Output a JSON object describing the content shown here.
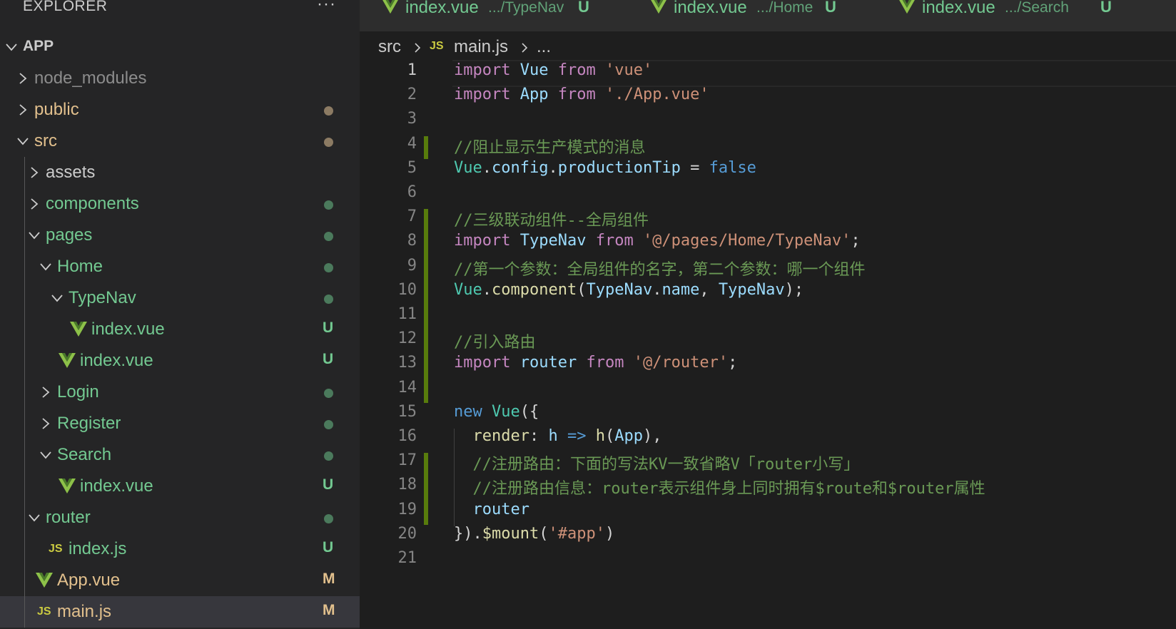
{
  "explorer": {
    "title": "EXPLORER",
    "more": "···",
    "tree": [
      {
        "label": "APP",
        "kind": "folder",
        "open": true,
        "depth": 0,
        "color": "#cccccc",
        "bold": true
      },
      {
        "label": "node_modules",
        "kind": "folder",
        "open": false,
        "depth": 1,
        "color": "#8c8c8c"
      },
      {
        "label": "public",
        "kind": "folder",
        "open": false,
        "depth": 1,
        "color": "#e2c08d",
        "dot": "#8c7b63"
      },
      {
        "label": "src",
        "kind": "folder",
        "open": true,
        "depth": 1,
        "color": "#e2c08d",
        "dot": "#8c7b63"
      },
      {
        "label": "assets",
        "kind": "folder",
        "open": false,
        "depth": 2,
        "color": "#cccccc"
      },
      {
        "label": "components",
        "kind": "folder",
        "open": false,
        "depth": 2,
        "color": "#73c991",
        "dot": "#4b7a5c"
      },
      {
        "label": "pages",
        "kind": "folder",
        "open": true,
        "depth": 2,
        "color": "#73c991",
        "dot": "#4b7a5c"
      },
      {
        "label": "Home",
        "kind": "folder",
        "open": true,
        "depth": 3,
        "color": "#73c991",
        "dot": "#4b7a5c"
      },
      {
        "label": "TypeNav",
        "kind": "folder",
        "open": true,
        "depth": 4,
        "color": "#73c991",
        "dot": "#4b7a5c"
      },
      {
        "label": "index.vue",
        "kind": "vue",
        "depth": 5,
        "color": "#73c991",
        "badge": "U",
        "badge_color": "#73c991"
      },
      {
        "label": "index.vue",
        "kind": "vue",
        "depth": 4,
        "color": "#73c991",
        "badge": "U",
        "badge_color": "#73c991"
      },
      {
        "label": "Login",
        "kind": "folder",
        "open": false,
        "depth": 3,
        "color": "#73c991",
        "dot": "#4b7a5c"
      },
      {
        "label": "Register",
        "kind": "folder",
        "open": false,
        "depth": 3,
        "color": "#73c991",
        "dot": "#4b7a5c"
      },
      {
        "label": "Search",
        "kind": "folder",
        "open": true,
        "depth": 3,
        "color": "#73c991",
        "dot": "#4b7a5c"
      },
      {
        "label": "index.vue",
        "kind": "vue",
        "depth": 4,
        "color": "#73c991",
        "badge": "U",
        "badge_color": "#73c991"
      },
      {
        "label": "router",
        "kind": "folder",
        "open": true,
        "depth": 2,
        "color": "#73c991",
        "dot": "#4b7a5c"
      },
      {
        "label": "index.js",
        "kind": "js",
        "depth": 3,
        "color": "#73c991",
        "badge": "U",
        "badge_color": "#73c991"
      },
      {
        "label": "App.vue",
        "kind": "vue",
        "depth": 2,
        "color": "#e2c08d",
        "badge": "M",
        "badge_color": "#e2c08d"
      },
      {
        "label": "main.js",
        "kind": "js",
        "depth": 2,
        "color": "#e2c08d",
        "badge": "M",
        "badge_color": "#e2c08d",
        "selected": true
      }
    ]
  },
  "tabs": [
    {
      "name": "index.vue",
      "path": ".../TypeNav",
      "badge": "U"
    },
    {
      "name": "index.vue",
      "path": ".../Home",
      "badge": "U"
    },
    {
      "name": "index.vue",
      "path": ".../Search",
      "badge": "U"
    }
  ],
  "breadcrumb": {
    "folder": "src",
    "js_badge": "JS",
    "file": "main.js",
    "more": "..."
  },
  "editor": {
    "active_line": 1,
    "lines": [
      {
        "n": "1",
        "tokens": [
          [
            "kw",
            "import"
          ],
          [
            "",
            "",
            " "
          ],
          [
            "vr",
            "Vue"
          ],
          [
            "",
            " "
          ],
          [
            "kw",
            "from"
          ],
          [
            "",
            " "
          ],
          [
            "str",
            "'vue'"
          ]
        ]
      },
      {
        "n": "2",
        "tokens": [
          [
            "kw",
            "import"
          ],
          [
            "",
            " "
          ],
          [
            "vr",
            "App"
          ],
          [
            "",
            " "
          ],
          [
            "kw",
            "from"
          ],
          [
            "",
            " "
          ],
          [
            "str",
            "'./App.vue'"
          ]
        ]
      },
      {
        "n": "3",
        "tokens": []
      },
      {
        "n": "4",
        "tokens": [
          [
            "cmt",
            "//阻止显示生产模式的消息"
          ]
        ]
      },
      {
        "n": "5",
        "tokens": [
          [
            "cls",
            "Vue"
          ],
          [
            "",
            "."
          ],
          [
            "vr",
            "config"
          ],
          [
            "",
            "."
          ],
          [
            "vr",
            "productionTip"
          ],
          [
            "",
            " = "
          ],
          [
            "kw2",
            "false"
          ]
        ]
      },
      {
        "n": "6",
        "tokens": []
      },
      {
        "n": "7",
        "tokens": [
          [
            "cmt",
            "//三级联动组件--全局组件"
          ]
        ]
      },
      {
        "n": "8",
        "tokens": [
          [
            "kw",
            "import"
          ],
          [
            "",
            " "
          ],
          [
            "vr",
            "TypeNav"
          ],
          [
            "",
            " "
          ],
          [
            "kw",
            "from"
          ],
          [
            "",
            " "
          ],
          [
            "str",
            "'@/pages/Home/TypeNav'"
          ],
          [
            "",
            ";"
          ]
        ]
      },
      {
        "n": "9",
        "tokens": [
          [
            "cmt",
            "//第一个参数：全局组件的名字，第二个参数：哪一个组件"
          ]
        ]
      },
      {
        "n": "10",
        "tokens": [
          [
            "cls",
            "Vue"
          ],
          [
            "",
            "."
          ],
          [
            "fn",
            "component"
          ],
          [
            "",
            "("
          ],
          [
            "vr",
            "TypeNav"
          ],
          [
            "",
            "."
          ],
          [
            "vr",
            "name"
          ],
          [
            "",
            ", "
          ],
          [
            "vr",
            "TypeNav"
          ],
          [
            "",
            ");"
          ]
        ]
      },
      {
        "n": "11",
        "tokens": []
      },
      {
        "n": "12",
        "tokens": [
          [
            "cmt",
            "//引入路由"
          ]
        ]
      },
      {
        "n": "13",
        "tokens": [
          [
            "kw",
            "import"
          ],
          [
            "",
            " "
          ],
          [
            "vr",
            "router"
          ],
          [
            "",
            " "
          ],
          [
            "kw",
            "from"
          ],
          [
            "",
            " "
          ],
          [
            "str",
            "'@/router'"
          ],
          [
            "",
            ";"
          ]
        ]
      },
      {
        "n": "14",
        "tokens": []
      },
      {
        "n": "15",
        "tokens": [
          [
            "kw2",
            "new"
          ],
          [
            "",
            " "
          ],
          [
            "cls",
            "Vue"
          ],
          [
            "",
            "({"
          ]
        ]
      },
      {
        "n": "16",
        "tokens": [
          [
            "",
            " "
          ],
          [
            "",
            " "
          ],
          [
            "fn",
            "render"
          ],
          [
            "",
            ": "
          ],
          [
            "vr",
            "h"
          ],
          [
            "",
            " "
          ],
          [
            "kw2",
            "=>"
          ],
          [
            "",
            " "
          ],
          [
            "fn",
            "h"
          ],
          [
            "",
            "("
          ],
          [
            "vr",
            "App"
          ],
          [
            "",
            "),"
          ]
        ]
      },
      {
        "n": "17",
        "tokens": [
          [
            "",
            "  "
          ],
          [
            "cmt",
            "//注册路由：下面的写法KV一致省略V「router小写」"
          ]
        ]
      },
      {
        "n": "18",
        "tokens": [
          [
            "",
            "  "
          ],
          [
            "cmt",
            "//注册路由信息：router表示组件身上同时拥有$route和$router属性"
          ]
        ]
      },
      {
        "n": "19",
        "tokens": [
          [
            "",
            "  "
          ],
          [
            "vr",
            "router"
          ]
        ]
      },
      {
        "n": "20",
        "tokens": [
          [
            "",
            "})."
          ],
          [
            "fn",
            "$mount"
          ],
          [
            "",
            "("
          ],
          [
            "str",
            "'#app'"
          ],
          [
            "",
            ")"
          ]
        ]
      },
      {
        "n": "21",
        "tokens": []
      }
    ],
    "git_modified_lines": [
      [
        4,
        4
      ],
      [
        7,
        14
      ],
      [
        17,
        19
      ]
    ]
  }
}
